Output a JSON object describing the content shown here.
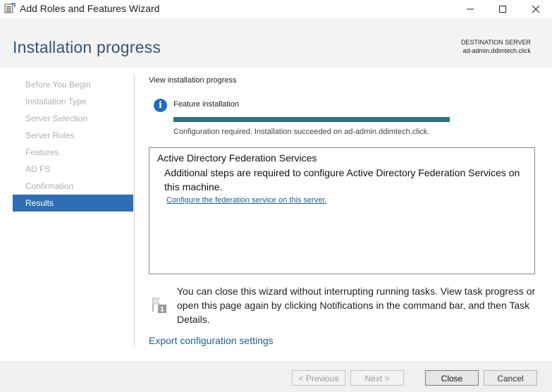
{
  "window": {
    "title": "Add Roles and Features Wizard",
    "minimize_icon": "minimize-icon",
    "maximize_icon": "maximize-icon",
    "close_icon": "close-icon"
  },
  "header": {
    "page_title": "Installation progress",
    "destination_label": "DESTINATION SERVER",
    "destination_server": "ad-admin.ddimtech.click"
  },
  "nav": {
    "items": [
      {
        "label": "Before You Begin",
        "active": false
      },
      {
        "label": "Installation Type",
        "active": false
      },
      {
        "label": "Server Selection",
        "active": false
      },
      {
        "label": "Server Roles",
        "active": false
      },
      {
        "label": "Features",
        "active": false
      },
      {
        "label": "AD FS",
        "active": false
      },
      {
        "label": "Confirmation",
        "active": false
      },
      {
        "label": "Results",
        "active": true
      }
    ]
  },
  "main": {
    "section_label": "View installation progress",
    "feature_label": "Feature installation",
    "progress_percent": 100,
    "progress_color": "#2f6f86",
    "status_text": "Configuration required. Installation succeeded on ad-admin.ddimtech.click.",
    "result": {
      "title": "Active Directory Federation Services",
      "description": "Additional steps are required to configure Active Directory Federation Services on this machine.",
      "link": "Configure the federation service on this server."
    },
    "notice": "You can close this wizard without interrupting running tasks. View task progress or open this page again by clicking Notifications in the command bar, and then Task Details.",
    "export_link": "Export configuration settings"
  },
  "footer": {
    "previous": "< Previous",
    "next": "Next >",
    "close": "Close",
    "cancel": "Cancel"
  },
  "colors": {
    "accent": "#2f6db5",
    "title_blue": "#35556f",
    "link_blue": "#1e5f8f"
  }
}
